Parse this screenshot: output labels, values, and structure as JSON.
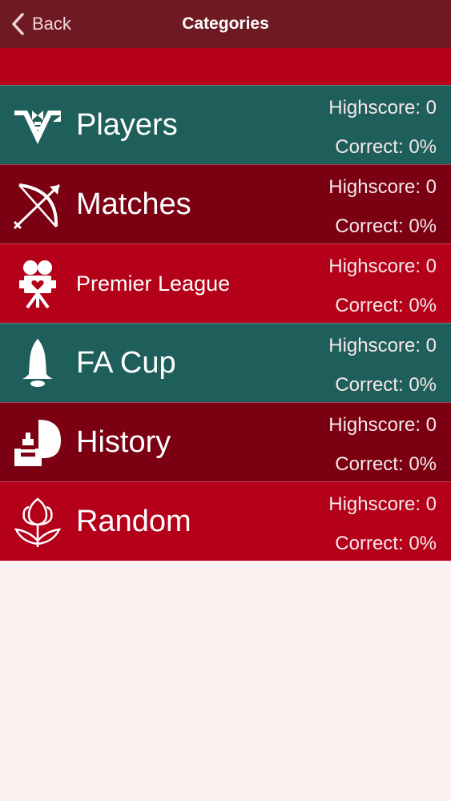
{
  "nav": {
    "back_label": "Back",
    "title": "Categories"
  },
  "categories": [
    {
      "name": "Players",
      "icon": "tuxedo-icon",
      "color": "#1f5f5b",
      "highscore": "Highscore: 0",
      "correct": "Correct: 0%"
    },
    {
      "name": "Matches",
      "icon": "bow-and-arrow-icon",
      "color": "#7a0012",
      "highscore": "Highscore: 0",
      "correct": "Correct: 0%"
    },
    {
      "name": "Premier League",
      "icon": "movie-camera-icon",
      "color": "#b5001a",
      "highscore": "Highscore: 0",
      "correct": "Correct: 0%"
    },
    {
      "name": "FA Cup",
      "icon": "bell-icon",
      "color": "#1f5f5b",
      "highscore": "Highscore: 0",
      "correct": "Correct: 0%"
    },
    {
      "name": "History",
      "icon": "sculpture-icon",
      "color": "#7a0012",
      "highscore": "Highscore: 0",
      "correct": "Correct: 0%"
    },
    {
      "name": "Random",
      "icon": "tulip-icon",
      "color": "#b5001a",
      "highscore": "Highscore: 0",
      "correct": "Correct: 0%"
    }
  ],
  "colors": {
    "navbar": "#6e1a23",
    "accent_red": "#b5001a",
    "teal": "#1f5f5b",
    "maroon": "#7a0012",
    "background": "#fdf0f1"
  }
}
